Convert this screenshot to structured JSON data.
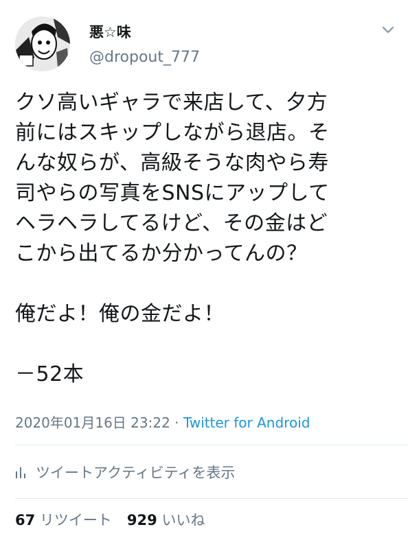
{
  "user": {
    "display_name": "悪☆味",
    "handle": "@dropout_777",
    "avatar_icon": "manga-avatar"
  },
  "menu_icon": "chevron-down-icon",
  "tweet": {
    "lines": [
      "クソ高いギャラで来店して、夕方",
      "前にはスキップしながら退店。そ",
      "んな奴らが、高級そうな肉やら寿",
      "司やらの写真をSNSにアップして",
      "ヘラヘラしてるけど、その金はど",
      "こから出てるか分かってんの？"
    ],
    "line2": "俺だよ！俺の金だよ！",
    "line3": "－52本"
  },
  "meta": {
    "timestamp": "2020年01月16日 23:22",
    "separator": " · ",
    "source": "Twitter for Android"
  },
  "activity": {
    "icon": "bar-chart-icon",
    "label": "ツイートアクティビティを表示"
  },
  "stats": {
    "retweets_count": "67",
    "retweets_label": "リツイート",
    "likes_count": "929",
    "likes_label": "いいね"
  },
  "colors": {
    "text": "#14171a",
    "secondary": "#657786",
    "link": "#1b95e0",
    "divider": "#e1e8ed"
  }
}
